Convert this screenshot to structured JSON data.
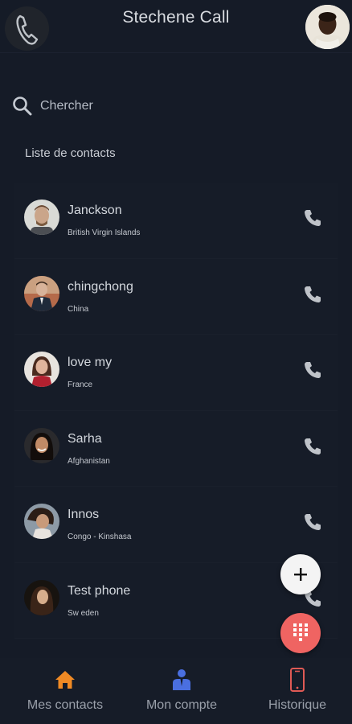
{
  "header": {
    "title": "Stechene Call",
    "logo_icon": "phone-icon",
    "profile_icon": "profile-avatar"
  },
  "search": {
    "placeholder": "Chercher",
    "icon": "search-icon"
  },
  "contacts_section": {
    "title": "Liste de contacts"
  },
  "contacts": [
    {
      "name": "Janckson",
      "country": "British Virgin Islands"
    },
    {
      "name": "chingchong",
      "country": "China"
    },
    {
      "name": "love my",
      "country": "France"
    },
    {
      "name": "Sarha",
      "country": "Afghanistan"
    },
    {
      "name": "Innos",
      "country": "Congo - Kinshasa"
    },
    {
      "name": "Test phone",
      "country": "Sw eden"
    }
  ],
  "fabs": {
    "add_icon": "plus-icon",
    "dial_icon": "dialpad-icon"
  },
  "bottom_nav": [
    {
      "label": "Mes contacts",
      "icon": "home-icon",
      "color": "#f08a24"
    },
    {
      "label": "Mon compte",
      "icon": "account-icon",
      "color": "#4a6fe0"
    },
    {
      "label": "Historique",
      "icon": "mobile-phone-icon",
      "color": "#e05a55"
    }
  ],
  "colors": {
    "background": "#151b27",
    "accent_add": "#f4f4f4",
    "accent_dial": "#ef6462"
  }
}
